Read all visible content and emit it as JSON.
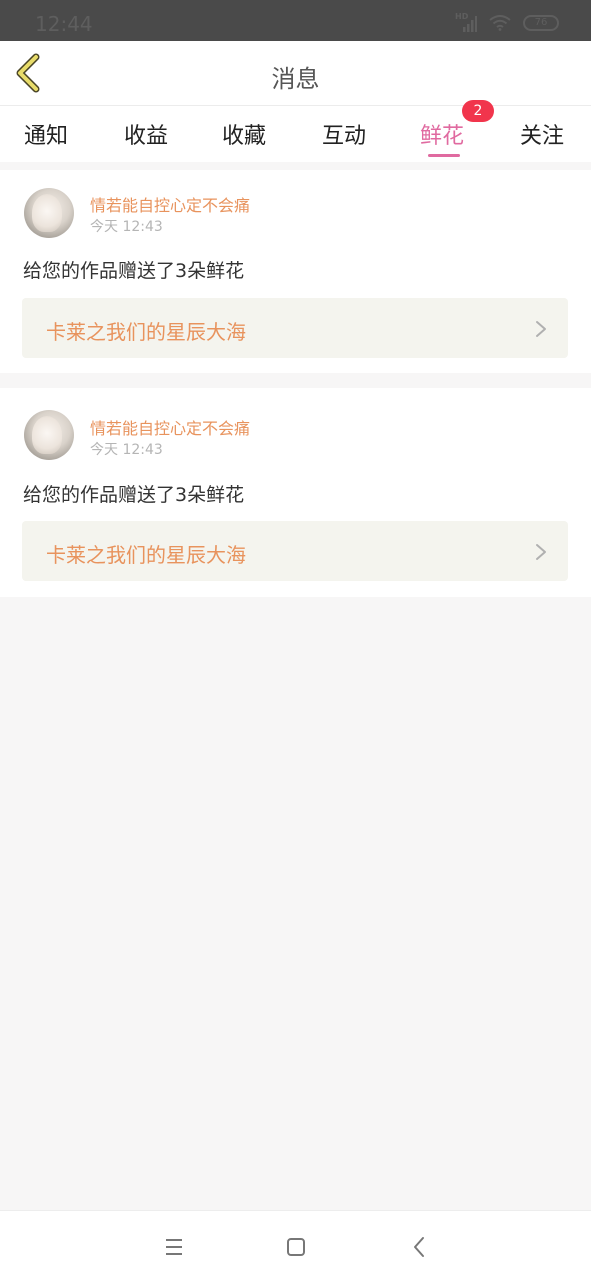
{
  "status": {
    "time": "12:44",
    "hd_label": "HD",
    "battery": "76"
  },
  "header": {
    "title": "消息"
  },
  "tabs": [
    {
      "label": "通知"
    },
    {
      "label": "收益"
    },
    {
      "label": "收藏"
    },
    {
      "label": "互动"
    },
    {
      "label": "鲜花",
      "active": true,
      "badge": "2"
    },
    {
      "label": "关注"
    }
  ],
  "notifications": [
    {
      "username": "情若能自控心定不会痛",
      "time": "今天 12:43",
      "message": "给您的作品赠送了3朵鲜花",
      "work_title": "卡莱之我们的星辰大海"
    },
    {
      "username": "情若能自控心定不会痛",
      "time": "今天 12:43",
      "message": "给您的作品赠送了3朵鲜花",
      "work_title": "卡莱之我们的星辰大海"
    }
  ],
  "colors": {
    "accent_pink": "#e06aa0",
    "username_orange": "#e8935d",
    "badge_red": "#f1354c",
    "back_arrow_yellow": "#e8dc6a"
  },
  "icons": {
    "back": "back-arrow-icon",
    "chevron": "chevron-right-icon",
    "nav_menu": "menu-icon",
    "nav_home": "home-square-icon",
    "nav_back": "back-icon"
  }
}
